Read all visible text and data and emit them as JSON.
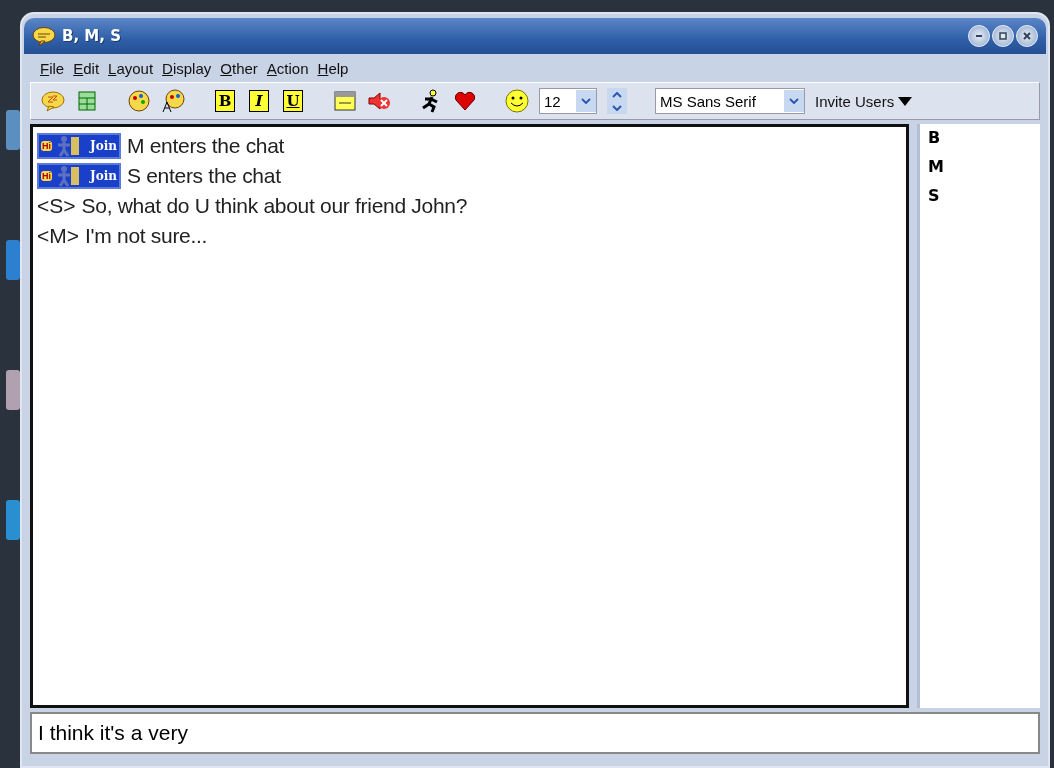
{
  "window": {
    "title": "B, M, S"
  },
  "menu": [
    {
      "label": "File"
    },
    {
      "label": "Edit"
    },
    {
      "label": "Layout"
    },
    {
      "label": "Display"
    },
    {
      "label": "Other"
    },
    {
      "label": "Action"
    },
    {
      "label": "Help"
    }
  ],
  "toolbar": {
    "tools": [
      {
        "kind": "sleep"
      },
      {
        "kind": "grid"
      },
      {
        "kind": "gap"
      },
      {
        "kind": "palette"
      },
      {
        "kind": "font-palette"
      },
      {
        "kind": "gap"
      },
      {
        "kind": "bold",
        "glyph": "B"
      },
      {
        "kind": "italic",
        "glyph": "I"
      },
      {
        "kind": "underline",
        "glyph": "U"
      },
      {
        "kind": "gap"
      },
      {
        "kind": "window"
      },
      {
        "kind": "mute"
      },
      {
        "kind": "gap"
      },
      {
        "kind": "runner"
      },
      {
        "kind": "heart"
      },
      {
        "kind": "gap"
      },
      {
        "kind": "smiley"
      }
    ],
    "font_size": "12",
    "font_name": "MS Sans Serif",
    "invite": "Invite Users"
  },
  "messages": [
    {
      "kind": "join",
      "badge_hi": "Hi",
      "badge_label": "Join",
      "text": "M enters the chat"
    },
    {
      "kind": "join",
      "badge_hi": "Hi",
      "badge_label": "Join",
      "text": "S enters the chat"
    },
    {
      "kind": "message",
      "sender": "<S>",
      "text": "So, what do U think about our friend John?"
    },
    {
      "kind": "message",
      "sender": "<M>",
      "text": "I'm not sure..."
    }
  ],
  "users": [
    "B",
    "M",
    "S"
  ],
  "input": {
    "value": "I think it's a very"
  }
}
